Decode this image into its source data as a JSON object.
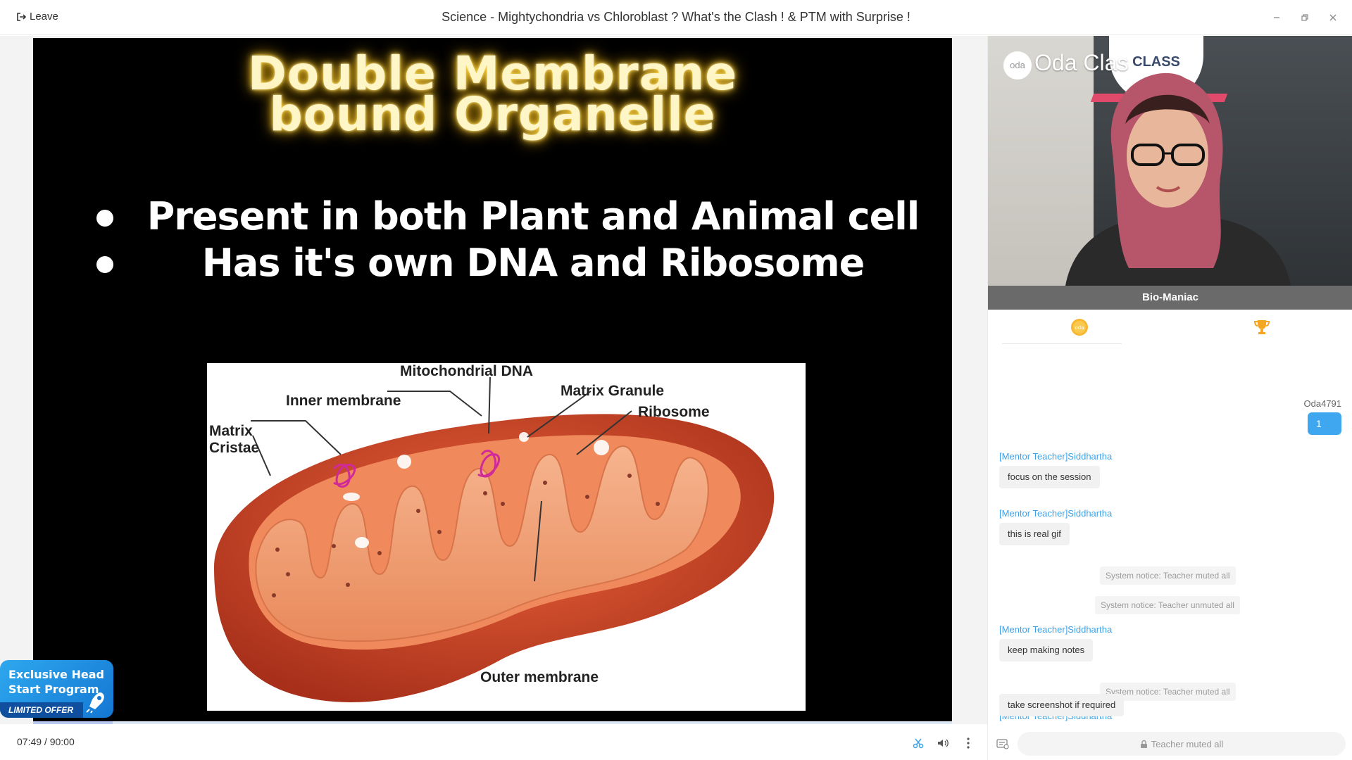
{
  "titlebar": {
    "leave_label": "Leave",
    "title": "Science - Mightychondria vs Chloroblast ? What's the Clash ! & PTM with Surprise !"
  },
  "slide": {
    "title_line1": "Double Membrane",
    "title_line2": "bound Organelle",
    "bullets": [
      "Present in both Plant and  Animal cell",
      "Has it's own DNA and Ribosome"
    ],
    "diagram_labels": {
      "mito_dna": "Mitochondrial DNA",
      "inner_membrane": "Inner membrane",
      "matrix_granule": "Matrix Granule",
      "ribosome": "Ribosome",
      "matrix": "Matrix",
      "cristae": "Cristae",
      "outer_membrane": "Outer membrane"
    }
  },
  "player": {
    "current_time": "07:49",
    "total_time": "90:00",
    "time_separator": " / ",
    "progress_fraction": 0.0868
  },
  "promo": {
    "title": "Exclusive Head Start Program",
    "tag": "LIMITED OFFER"
  },
  "video": {
    "logo_small": "oda",
    "logo_text": "Oda Clas",
    "badge_top": "oda",
    "badge_text": "CLASS",
    "teacher_name": "Bio-Maniac"
  },
  "chat": {
    "me_user": "Oda4791",
    "me_message": "1",
    "messages": [
      {
        "sender": "[Mentor Teacher]Siddhartha",
        "text": "focus on the session"
      },
      {
        "sender": "[Mentor Teacher]Siddhartha",
        "text": "this is real gif"
      },
      {
        "sender": "[Mentor Teacher]Siddhartha",
        "text": "keep making notes"
      },
      {
        "sender": "[Mentor Teacher]Siddhartha",
        "text": "take screenshot if required"
      }
    ],
    "system_notices": [
      "System notice: Teacher muted all",
      "System notice: Teacher unmuted all",
      "System notice: Teacher muted all"
    ],
    "input_placeholder": "Teacher muted all"
  },
  "colors": {
    "accent_blue": "#3da2e8",
    "bubble_blue": "#3fa7f0",
    "promo_blue": "#1477d3",
    "glow_yellow": "#ffd84a"
  }
}
